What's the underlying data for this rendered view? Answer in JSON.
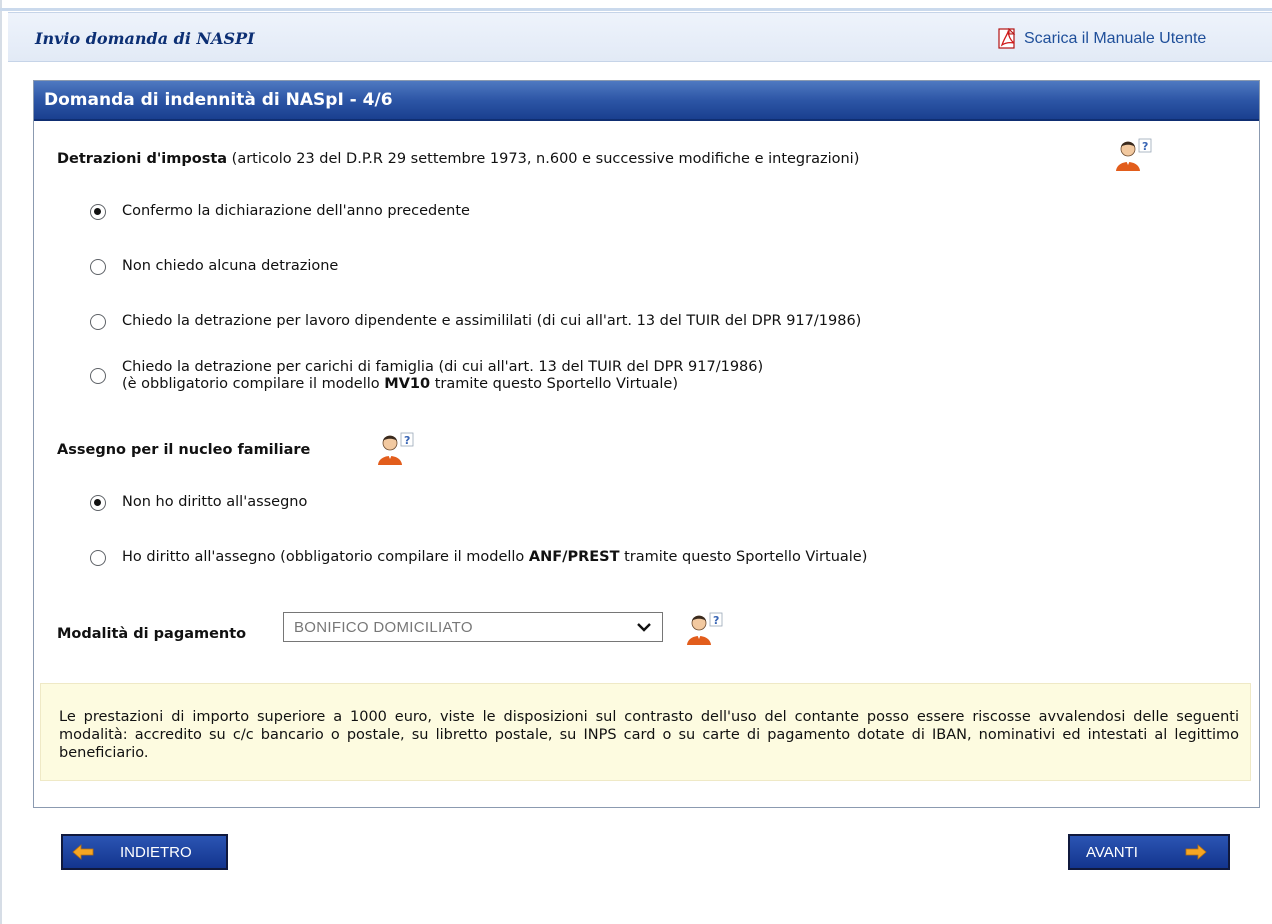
{
  "header": {
    "title": "Invio domanda di NASPI",
    "manual_link": "Scarica il Manuale Utente"
  },
  "panel": {
    "title": "Domanda di indennità di NASpI - 4/6"
  },
  "tax_section": {
    "label_bold": "Detrazioni d'imposta",
    "label_rest": " (articolo 23 del D.P.R 29 settembre 1973, n.600 e successive modifiche e integrazioni)",
    "options": [
      {
        "text": "Confermo la dichiarazione dell'anno precedente",
        "checked": true
      },
      {
        "text": "Non chiedo alcuna detrazione",
        "checked": false
      },
      {
        "text": "Chiedo la detrazione per lavoro dipendente e assimililati (di cui all'art. 13 del TUIR del DPR 917/1986)",
        "checked": false
      },
      {
        "line1": "Chiedo la detrazione per carichi di famiglia (di cui all'art. 13 del TUIR del DPR 917/1986)",
        "line2_pre": "(è obbligatorio compilare il modello ",
        "line2_bold": "MV10",
        "line2_post": " tramite questo Sportello Virtuale)",
        "checked": false
      }
    ]
  },
  "family_section": {
    "label": "Assegno per il nucleo familiare",
    "options": [
      {
        "text": "Non ho diritto all'assegno",
        "checked": true
      },
      {
        "text_pre": "Ho diritto all'assegno (obbligatorio compilare il modello ",
        "text_bold": "ANF/PREST",
        "text_post": " tramite questo Sportello Virtuale)",
        "checked": false
      }
    ]
  },
  "payment": {
    "label": "Modalità di pagamento",
    "selected": "BONIFICO DOMICILIATO"
  },
  "notice": {
    "text": "Le prestazioni di importo superiore a 1000 euro, viste le disposizioni sul contrasto dell'uso del contante posso essere riscosse avvalendosi delle seguenti modalità: accredito su c/c bancario o postale, su libretto postale, su INPS card o su carte di pagamento dotate di IBAN, nominativi ed intestati al legittimo beneficiario."
  },
  "buttons": {
    "back": "INDIETRO",
    "next": "AVANTI"
  },
  "colors": {
    "header_bg": "#e2eaf6",
    "panel_head": "#2d56a6",
    "button_bg": "#1f47a3",
    "arrow": "#f6a623",
    "notice_bg": "#fdfbe0"
  },
  "icons": [
    "pdf-icon",
    "help-user-icon",
    "arrow-left-icon",
    "arrow-right-icon",
    "chevron-down-icon"
  ]
}
